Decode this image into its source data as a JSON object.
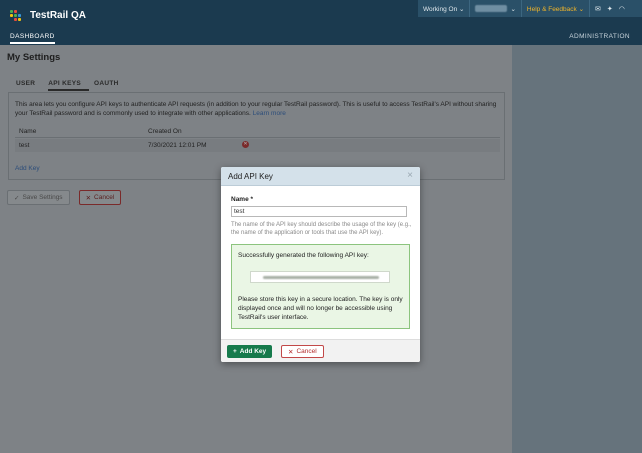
{
  "app": {
    "title": "TestRail QA"
  },
  "topbar": {
    "working_on": "Working On ⌄",
    "help": "Help & Feedback ⌄"
  },
  "nav": {
    "dashboard": "DASHBOARD",
    "administration": "ADMINISTRATION"
  },
  "page": {
    "title": "My Settings"
  },
  "tabs": [
    {
      "label": "USER"
    },
    {
      "label": "API KEYS"
    },
    {
      "label": "OAUTH"
    }
  ],
  "api_panel": {
    "description": "This area lets you configure API keys to authenticate API requests (in addition to your regular TestRail password). This is useful to access TestRail's API without sharing your TestRail password and is commonly used to integrate with other applications.",
    "learn_more": "Learn more",
    "columns": {
      "name": "Name",
      "created_on": "Created On"
    },
    "rows": [
      {
        "name": "test",
        "created_on": "7/30/2021 12:01 PM"
      }
    ],
    "add_key": "Add Key"
  },
  "buttons": {
    "save_settings": "Save Settings",
    "cancel": "Cancel"
  },
  "modal": {
    "title": "Add API Key",
    "name_label": "Name *",
    "name_value": "test",
    "hint": "The name of the API key should describe the usage of the key (e.g., the name of the application or tools that use the API key).",
    "success_title": "Successfully generated the following API key:",
    "success_note": "Please store this key in a secure location. The key is only displayed once and will no longer be accessible using TestRail's user interface.",
    "add_button": "Add Key",
    "cancel_button": "Cancel"
  },
  "colors": {
    "brand": "#1b3a4f",
    "primary_button": "#167a4c",
    "danger": "#b22b2b",
    "success_bg": "#eaf6e5"
  }
}
